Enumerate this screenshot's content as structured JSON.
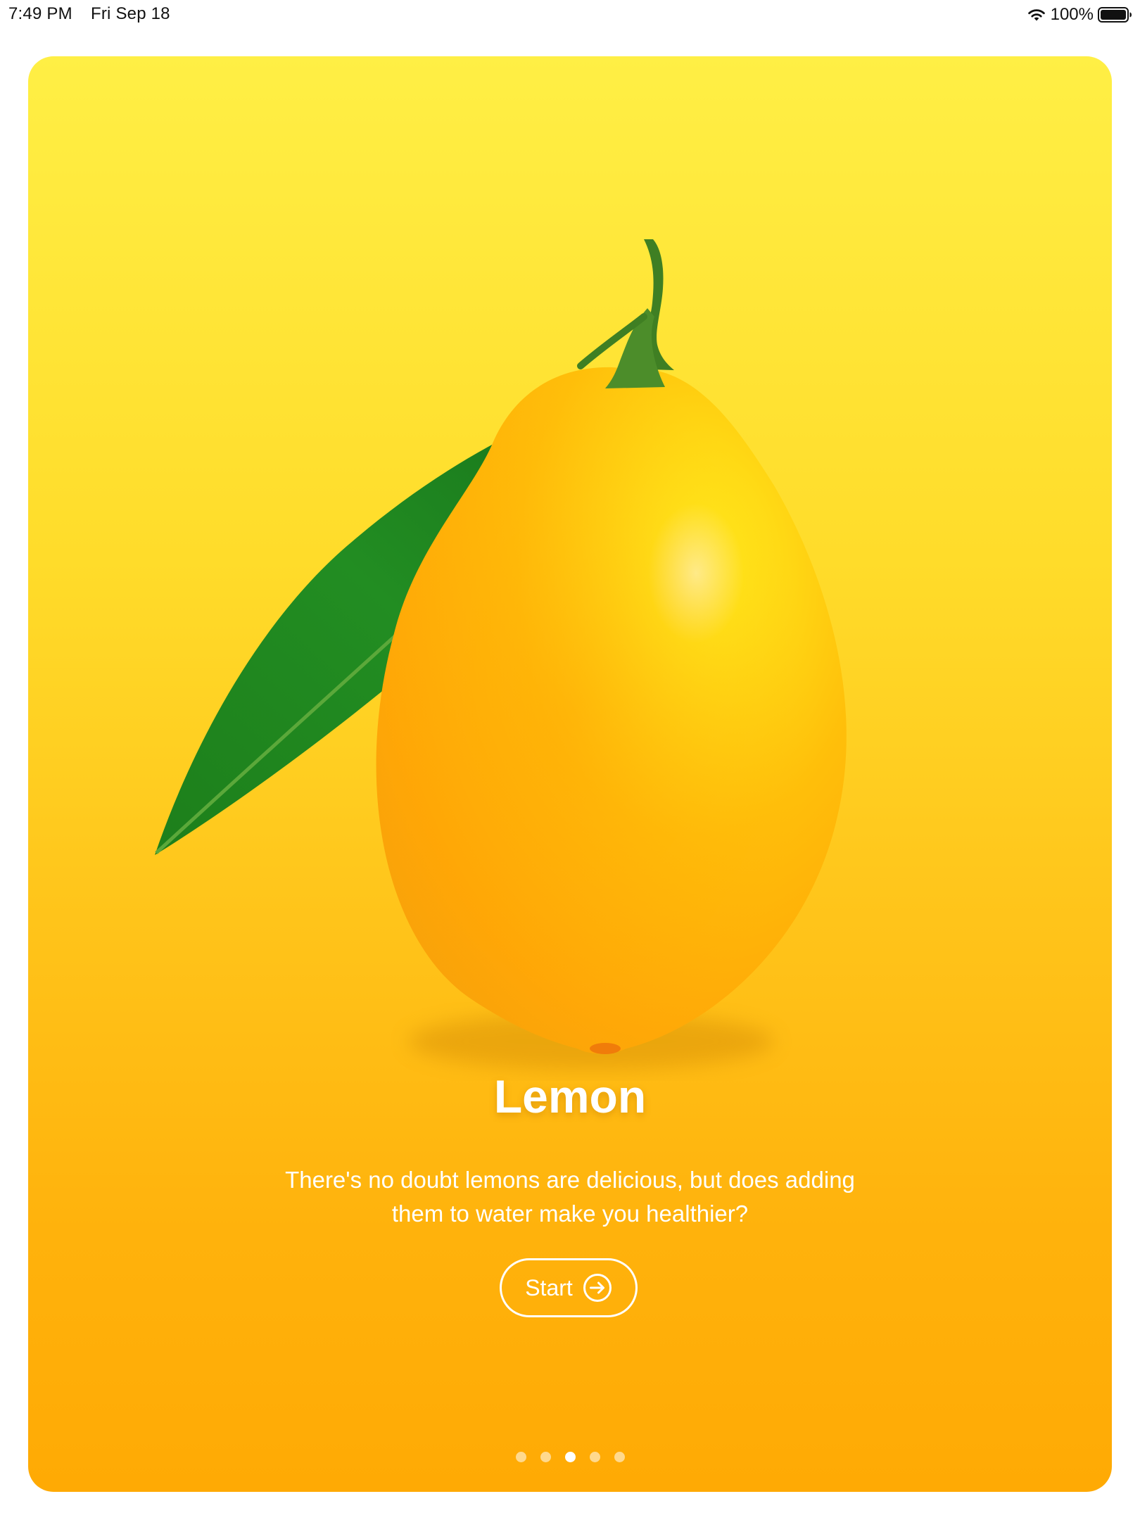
{
  "status_bar": {
    "time": "7:49 PM",
    "date": "Fri Sep 18",
    "battery": "100%",
    "wifi_icon": "wifi-icon",
    "battery_icon": "battery-full-icon"
  },
  "card": {
    "title": "Lemon",
    "description": "There's no doubt lemons are delicious, but does adding them to water make you healthier?",
    "start_label": "Start",
    "start_icon": "arrow-right-circle-icon",
    "image": "lemon-with-leaf-image",
    "colors": {
      "gradient_top": "#ffef45",
      "gradient_bottom": "#ffaa04",
      "text": "#ffffff"
    }
  },
  "pagination": {
    "total": 5,
    "active_index": 2
  }
}
